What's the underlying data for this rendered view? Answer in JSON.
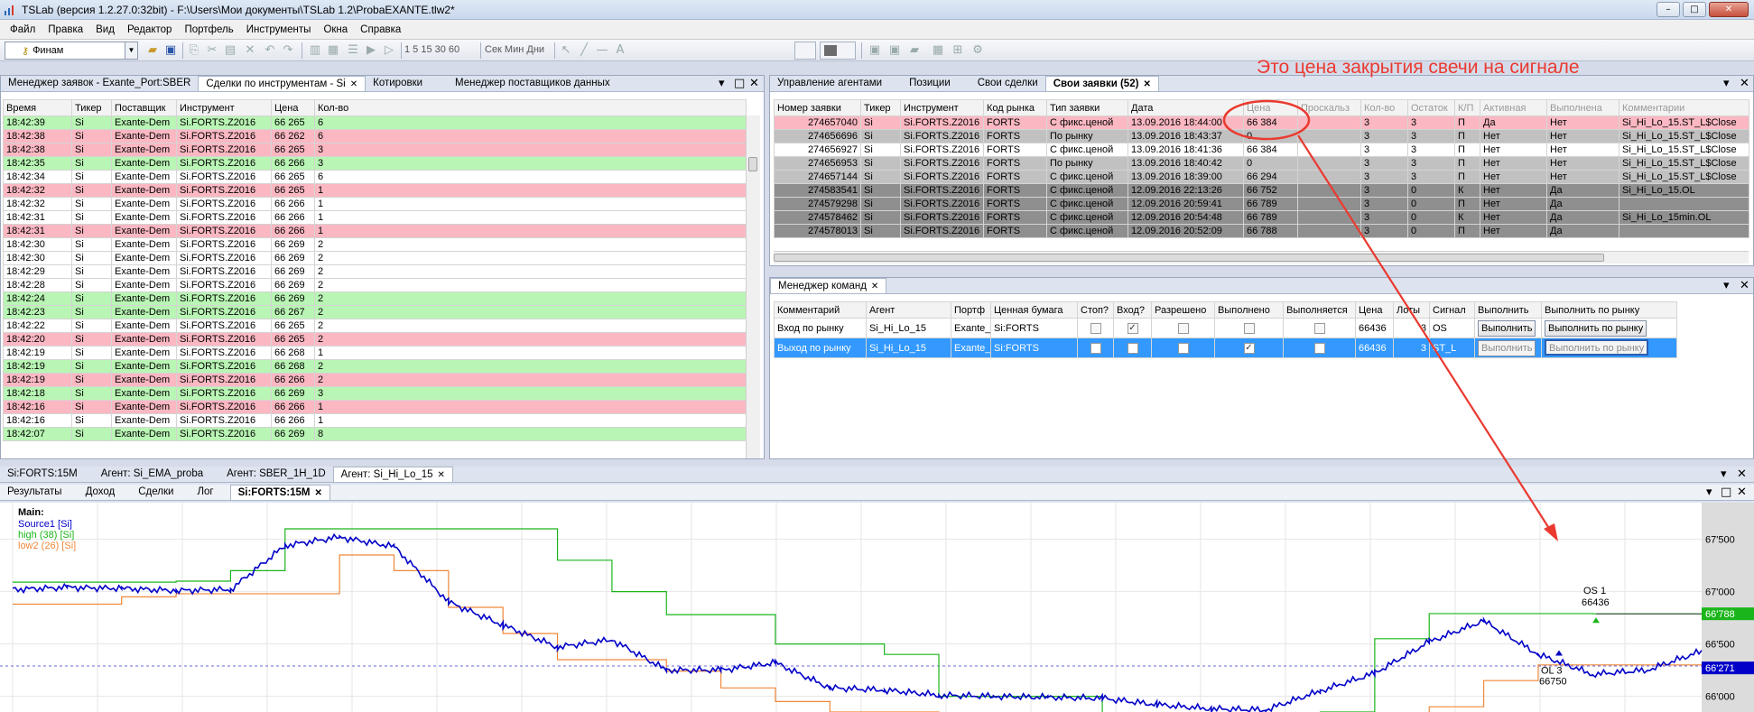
{
  "title": "TSLab (версия 1.2.27.0:32bit) - F:\\Users\\Мои документы\\TSLab 1.2\\ProbaEXANTE.tlw2*",
  "menu": [
    "Файл",
    "Правка",
    "Вид",
    "Редактор",
    "Портфель",
    "Инструменты",
    "Окна",
    "Справка"
  ],
  "toolbar": {
    "provider": "Финам",
    "timeframes": "1  5  15  30  60",
    "units": "Сек  Мин  Дни"
  },
  "colors": {
    "green": "#b9f5b4",
    "pink": "#fbb8c2",
    "selected": "#3399ff",
    "annotation": "#ea3a30",
    "source": "#0000c8",
    "high": "#1ab51a",
    "low": "#f0883a"
  },
  "annotation": "Это цена закрытия свечи на сигнале",
  "orders_panel": {
    "tabs": [
      {
        "label": "Менеджер заявок - Exante_Port:SBER"
      },
      {
        "label": "Сделки по инструментам - Si"
      },
      {
        "label": "Котировки"
      },
      {
        "label": "Менеджер поставщиков данных"
      }
    ],
    "columns": [
      "Время",
      "Тикер",
      "Поставщик",
      "Инструмент",
      "Цена",
      "Кол-во"
    ],
    "rows": [
      [
        "18:42:39",
        "Si",
        "Exante-Dem",
        "Si.FORTS.Z2016",
        "66 265",
        "6",
        "g"
      ],
      [
        "18:42:38",
        "Si",
        "Exante-Dem",
        "Si.FORTS.Z2016",
        "66 262",
        "6",
        "r"
      ],
      [
        "18:42:38",
        "Si",
        "Exante-Dem",
        "Si.FORTS.Z2016",
        "66 265",
        "3",
        "r"
      ],
      [
        "18:42:35",
        "Si",
        "Exante-Dem",
        "Si.FORTS.Z2016",
        "66 266",
        "3",
        "g"
      ],
      [
        "18:42:34",
        "Si",
        "Exante-Dem",
        "Si.FORTS.Z2016",
        "66 265",
        "6",
        "w"
      ],
      [
        "18:42:32",
        "Si",
        "Exante-Dem",
        "Si.FORTS.Z2016",
        "66 265",
        "1",
        "r"
      ],
      [
        "18:42:32",
        "Si",
        "Exante-Dem",
        "Si.FORTS.Z2016",
        "66 266",
        "1",
        "w"
      ],
      [
        "18:42:31",
        "Si",
        "Exante-Dem",
        "Si.FORTS.Z2016",
        "66 266",
        "1",
        "w"
      ],
      [
        "18:42:31",
        "Si",
        "Exante-Dem",
        "Si.FORTS.Z2016",
        "66 266",
        "1",
        "r"
      ],
      [
        "18:42:30",
        "Si",
        "Exante-Dem",
        "Si.FORTS.Z2016",
        "66 269",
        "2",
        "w"
      ],
      [
        "18:42:30",
        "Si",
        "Exante-Dem",
        "Si.FORTS.Z2016",
        "66 269",
        "2",
        "w"
      ],
      [
        "18:42:29",
        "Si",
        "Exante-Dem",
        "Si.FORTS.Z2016",
        "66 269",
        "2",
        "w"
      ],
      [
        "18:42:28",
        "Si",
        "Exante-Dem",
        "Si.FORTS.Z2016",
        "66 269",
        "2",
        "w"
      ],
      [
        "18:42:24",
        "Si",
        "Exante-Dem",
        "Si.FORTS.Z2016",
        "66 269",
        "2",
        "g"
      ],
      [
        "18:42:23",
        "Si",
        "Exante-Dem",
        "Si.FORTS.Z2016",
        "66 267",
        "2",
        "g"
      ],
      [
        "18:42:22",
        "Si",
        "Exante-Dem",
        "Si.FORTS.Z2016",
        "66 265",
        "2",
        "w"
      ],
      [
        "18:42:20",
        "Si",
        "Exante-Dem",
        "Si.FORTS.Z2016",
        "66 265",
        "2",
        "r"
      ],
      [
        "18:42:19",
        "Si",
        "Exante-Dem",
        "Si.FORTS.Z2016",
        "66 268",
        "1",
        "w"
      ],
      [
        "18:42:19",
        "Si",
        "Exante-Dem",
        "Si.FORTS.Z2016",
        "66 268",
        "2",
        "g"
      ],
      [
        "18:42:19",
        "Si",
        "Exante-Dem",
        "Si.FORTS.Z2016",
        "66 266",
        "2",
        "r"
      ],
      [
        "18:42:18",
        "Si",
        "Exante-Dem",
        "Si.FORTS.Z2016",
        "66 269",
        "3",
        "g"
      ],
      [
        "18:42:16",
        "Si",
        "Exante-Dem",
        "Si.FORTS.Z2016",
        "66 266",
        "1",
        "r"
      ],
      [
        "18:42:16",
        "Si",
        "Exante-Dem",
        "Si.FORTS.Z2016",
        "66 266",
        "1",
        "w"
      ],
      [
        "18:42:07",
        "Si",
        "Exante-Dem",
        "Si.FORTS.Z2016",
        "66 269",
        "8",
        "g"
      ]
    ]
  },
  "agents_panel": {
    "tabs": [
      {
        "label": "Управление агентами"
      },
      {
        "label": "Позиции"
      },
      {
        "label": "Свои сделки"
      },
      {
        "label": "Свои заявки (52)"
      }
    ],
    "columns": [
      "Номер заявки",
      "Тикер",
      "Инструмент",
      "Код рынка",
      "Тип заявки",
      "Дата",
      "Цена",
      "Проскальз",
      "Кол-во",
      "Остаток",
      "К/П",
      "Активная",
      "Выполнена",
      "Комментарии"
    ],
    "rows": [
      [
        "274657040",
        "Si",
        "Si.FORTS.Z2016",
        "FORTS",
        "С фикс.ценой",
        "13.09.2016 18:44:00",
        "66 384",
        "",
        "3",
        "3",
        "П",
        "Да",
        "Нет",
        "Si_Hi_Lo_15.ST_L$Close",
        "o-pink"
      ],
      [
        "274656696",
        "Si",
        "Si.FORTS.Z2016",
        "FORTS",
        "По рынку",
        "13.09.2016 18:43:37",
        "0",
        "",
        "3",
        "3",
        "П",
        "Нет",
        "Нет",
        "Si_Hi_Lo_15.ST_L$Close",
        "o-gray"
      ],
      [
        "274656927",
        "Si",
        "Si.FORTS.Z2016",
        "FORTS",
        "С фикс.ценой",
        "13.09.2016 18:41:36",
        "66 384",
        "",
        "3",
        "3",
        "П",
        "Нет",
        "Нет",
        "Si_Hi_Lo_15.ST_L$Close",
        "o-white"
      ],
      [
        "274656953",
        "Si",
        "Si.FORTS.Z2016",
        "FORTS",
        "По рынку",
        "13.09.2016 18:40:42",
        "0",
        "",
        "3",
        "3",
        "П",
        "Нет",
        "Нет",
        "Si_Hi_Lo_15.ST_L$Close",
        "o-gray"
      ],
      [
        "274657144",
        "Si",
        "Si.FORTS.Z2016",
        "FORTS",
        "С фикс.ценой",
        "13.09.2016 18:39:00",
        "66 294",
        "",
        "3",
        "3",
        "П",
        "Нет",
        "Нет",
        "Si_Hi_Lo_15.ST_L$Close",
        "o-gray"
      ],
      [
        "274583541",
        "Si",
        "Si.FORTS.Z2016",
        "FORTS",
        "С фикс.ценой",
        "12.09.2016 22:13:26",
        "66 752",
        "",
        "3",
        "0",
        "К",
        "Нет",
        "Да",
        "Si_Hi_Lo_15.OL",
        "o-dgray"
      ],
      [
        "274579298",
        "Si",
        "Si.FORTS.Z2016",
        "FORTS",
        "С фикс.ценой",
        "12.09.2016 20:59:41",
        "66 789",
        "",
        "3",
        "0",
        "П",
        "Нет",
        "Да",
        "",
        "o-dgray"
      ],
      [
        "274578462",
        "Si",
        "Si.FORTS.Z2016",
        "FORTS",
        "С фикс.ценой",
        "12.09.2016 20:54:48",
        "66 789",
        "",
        "3",
        "0",
        "К",
        "Нет",
        "Да",
        "Si_Hi_Lo_15min.OL",
        "o-dgray"
      ],
      [
        "274578013",
        "Si",
        "Si.FORTS.Z2016",
        "FORTS",
        "С фикс.ценой",
        "12.09.2016 20:52:09",
        "66 788",
        "",
        "3",
        "0",
        "П",
        "Нет",
        "Да",
        "",
        "o-dgray"
      ]
    ]
  },
  "commands_panel": {
    "tabs": [
      {
        "label": "Менеджер команд"
      }
    ],
    "columns": [
      "Комментарий",
      "Агент",
      "Портф",
      "Ценная бумага",
      "Стоп?",
      "Вход?",
      "Разрешено",
      "Выполнено",
      "Выполняется",
      "Цена",
      "Лоты",
      "Сигнал",
      "Выполнить",
      "Выполнить по рынку"
    ],
    "rows": [
      {
        "comment": "Вход по рынку",
        "agent": "Si_Hi_Lo_15",
        "portf": "Exante_",
        "security": "Si:FORTS",
        "stop": false,
        "entry": true,
        "allowed": false,
        "done": false,
        "running": false,
        "price": "66436",
        "lots": "3",
        "signal": "OS",
        "exec": "Выполнить",
        "exec_market": "Выполнить по рынку",
        "selected": false
      },
      {
        "comment": "Выход по рынку",
        "agent": "Si_Hi_Lo_15",
        "portf": "Exante_",
        "security": "Si:FORTS",
        "stop": false,
        "entry": false,
        "allowed": false,
        "done": true,
        "running": false,
        "price": "66436",
        "lots": "3",
        "signal": "ST_L",
        "exec": "Выполнить",
        "exec_market": "Выполнить по рынку",
        "selected": true
      }
    ]
  },
  "bottom_tabs": [
    {
      "label": "Si:FORTS:15M"
    },
    {
      "label": "Агент: Si_EMA_proba"
    },
    {
      "label": "Агент: SBER_1H_1D"
    },
    {
      "label": "Агент: Si_Hi_Lo_15"
    }
  ],
  "chart_tabs": [
    {
      "label": "Результаты"
    },
    {
      "label": "Доход"
    },
    {
      "label": "Сделки"
    },
    {
      "label": "Лог"
    },
    {
      "label": "Si:FORTS:15M"
    }
  ],
  "chart_data": {
    "type": "line",
    "title": "Main:",
    "legend": [
      {
        "name": "Source1 [Si]",
        "color": "#0000c8"
      },
      {
        "name": "high (38) [Si]",
        "color": "#1ab51a"
      },
      {
        "name": "low2 (26) [Si]",
        "color": "#f0883a"
      }
    ],
    "y_ticks": [
      "67'500",
      "67'000",
      "66'500",
      "66'000"
    ],
    "y_tick_values": [
      67500,
      67000,
      66500,
      66000
    ],
    "ylim": [
      65850,
      67850
    ],
    "price_labels": [
      {
        "text": "66'788",
        "value": 66788,
        "color": "#1ab51a"
      },
      {
        "text": "66'271",
        "value": 66271,
        "color": "#0000c8"
      }
    ],
    "dashed_level": 66290,
    "annotations": [
      {
        "text": "OS 1",
        "sub": "66436"
      },
      {
        "text": "OL 3",
        "sub": "66750"
      }
    ],
    "x": [
      0,
      5,
      10,
      15,
      20,
      25,
      30,
      35,
      40,
      45,
      50,
      55,
      60,
      65,
      70,
      75,
      80,
      85,
      90,
      95,
      100
    ],
    "series": [
      {
        "name": "Source1 [Si]",
        "values": [
          67020,
          67040,
          67030,
          67010,
          67020,
          67440,
          67520,
          67430,
          66900,
          66680,
          66470,
          66540,
          66250,
          66250,
          66320,
          66080,
          66060,
          66010,
          66000,
          65990,
          65980,
          65920,
          65880,
          65870,
          66050,
          66220,
          66520,
          66720,
          66400,
          66210,
          66250,
          66430
        ]
      },
      {
        "name": "high (38) [Si]",
        "values": [
          67090,
          67090,
          67090,
          67100,
          67200,
          67600,
          67600,
          67600,
          67600,
          67600,
          67300,
          67000,
          66780,
          66780,
          66500,
          66500,
          66400,
          66000,
          66000,
          66000,
          65800,
          65800,
          65800,
          65800,
          65850,
          66550,
          66790,
          66790,
          66790,
          66788,
          66788,
          66788
        ]
      },
      {
        "name": "low2 (26) [Si]",
        "values": [
          66880,
          66880,
          66950,
          66980,
          66980,
          66980,
          67350,
          67200,
          66850,
          66600,
          66350,
          66350,
          66240,
          66080,
          65950,
          65850,
          65850,
          65800,
          65800,
          65800,
          65800,
          65800,
          65700,
          65700,
          65700,
          65700,
          65900,
          66150,
          66300,
          66300,
          66300,
          66300
        ]
      }
    ]
  }
}
